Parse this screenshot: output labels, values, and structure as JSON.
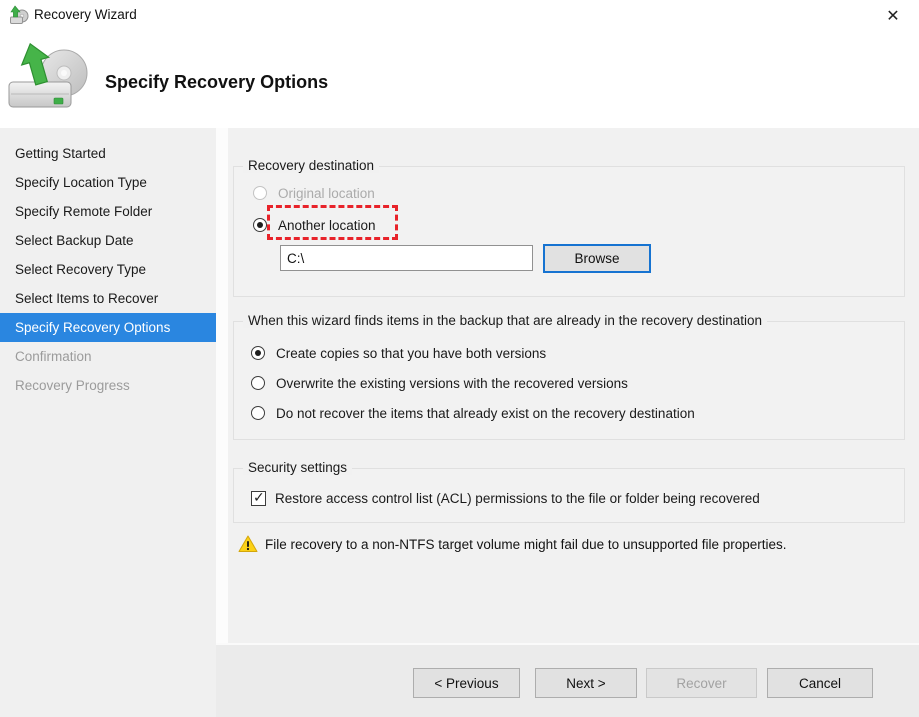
{
  "window": {
    "title": "Recovery Wizard",
    "close_glyph": "✕"
  },
  "header": {
    "title": "Specify Recovery Options"
  },
  "sidebar": {
    "items": [
      {
        "label": "Getting Started",
        "state": "done"
      },
      {
        "label": "Specify Location Type",
        "state": "done"
      },
      {
        "label": "Specify Remote Folder",
        "state": "done"
      },
      {
        "label": "Select Backup Date",
        "state": "done"
      },
      {
        "label": "Select Recovery Type",
        "state": "done"
      },
      {
        "label": "Select Items to Recover",
        "state": "done"
      },
      {
        "label": "Specify Recovery Options",
        "state": "current"
      },
      {
        "label": "Confirmation",
        "state": "pending"
      },
      {
        "label": "Recovery Progress",
        "state": "pending"
      }
    ]
  },
  "destination": {
    "group_label": "Recovery destination",
    "original_label": "Original location",
    "original_disabled": true,
    "another_label": "Another location",
    "another_selected": true,
    "path_value": "C:\\",
    "browse_label": "Browse",
    "annotation": "red dashed rectangle highlighting Another location"
  },
  "conflict": {
    "group_label": "When this wizard finds items in the backup that are already in the recovery destination",
    "options": [
      {
        "label": "Create copies so that you have both versions",
        "selected": true
      },
      {
        "label": "Overwrite the existing versions with the recovered versions",
        "selected": false
      },
      {
        "label": "Do not recover the items that already exist on the recovery destination",
        "selected": false
      }
    ]
  },
  "security": {
    "group_label": "Security settings",
    "acl_label": "Restore access control list (ACL) permissions to the file or folder being recovered",
    "acl_checked": true
  },
  "warning": {
    "text": "File recovery to a non-NTFS target volume might fail due to unsupported file properties."
  },
  "footer": {
    "previous_label": "< Previous",
    "next_label": "Next >",
    "recover_label": "Recover",
    "cancel_label": "Cancel"
  },
  "colors": {
    "sidebar_highlight": "#2a86e0",
    "browse_focus_border": "#1673d1",
    "annotation_red": "#e8232a",
    "warning_yellow": "#fcd116"
  }
}
